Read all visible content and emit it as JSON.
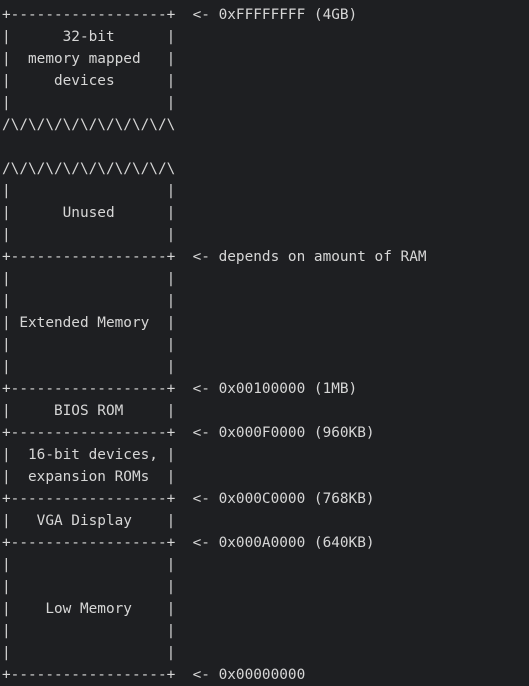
{
  "memory_map": {
    "lines": [
      "+------------------+  <- 0xFFFFFFFF (4GB)",
      "|      32-bit      |",
      "|  memory mapped   |",
      "|     devices      |",
      "|                  |",
      "/\\/\\/\\/\\/\\/\\/\\/\\/\\/\\",
      "",
      "/\\/\\/\\/\\/\\/\\/\\/\\/\\/\\",
      "|                  |",
      "|      Unused      |",
      "|                  |",
      "+------------------+  <- depends on amount of RAM",
      "|                  |",
      "|                  |",
      "| Extended Memory  |",
      "|                  |",
      "|                  |",
      "+------------------+  <- 0x00100000 (1MB)",
      "|     BIOS ROM     |",
      "+------------------+  <- 0x000F0000 (960KB)",
      "|  16-bit devices, |",
      "|  expansion ROMs  |",
      "+------------------+  <- 0x000C0000 (768KB)",
      "|   VGA Display    |",
      "+------------------+  <- 0x000A0000 (640KB)",
      "|                  |",
      "|                  |",
      "|    Low Memory    |",
      "|                  |",
      "|                  |",
      "+------------------+  <- 0x00000000"
    ]
  }
}
